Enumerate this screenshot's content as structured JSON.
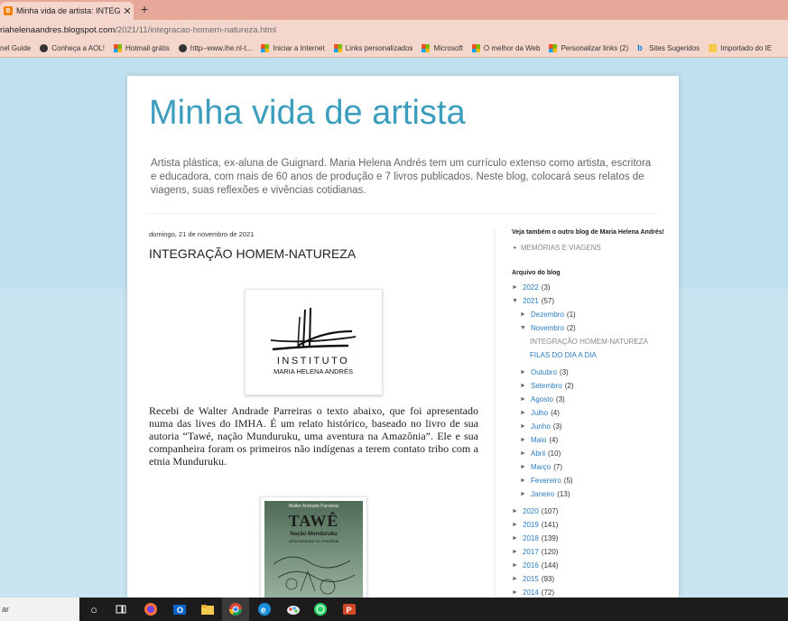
{
  "browser": {
    "tab_title": "Minha vida de artista: INTEGRAÇ",
    "tab_favicon": "B",
    "close_glyph": "✕",
    "new_tab_glyph": "+",
    "url_host": "riahelenaandres.blogspot.com",
    "url_path": "/2021/11/integracao-homem-natureza.html",
    "bookmarks": [
      {
        "label": "nel Guide",
        "icon": "none"
      },
      {
        "label": "Conheça a AOL!",
        "icon": "globe"
      },
      {
        "label": "Hotmail grátis",
        "icon": "ms"
      },
      {
        "label": "http--www.ihe.nl-t...",
        "icon": "globe"
      },
      {
        "label": "Iniciar a Internet",
        "icon": "ms"
      },
      {
        "label": "Links personalizados",
        "icon": "ms"
      },
      {
        "label": "Microsoft",
        "icon": "ms"
      },
      {
        "label": "O melhor da Web",
        "icon": "ms"
      },
      {
        "label": "Personalizar links (2)",
        "icon": "ms"
      },
      {
        "label": "Sites Sugeridos",
        "icon": "bing"
      },
      {
        "label": "Importado do IE",
        "icon": "folder"
      }
    ]
  },
  "blog": {
    "title": "Minha vida de artista",
    "description": "Artista plástica, ex-aluna de Guignard. Maria Helena Andrés tem um currículo extenso como artista, escritora e educadora, com mais de 60 anos de produção e 7 livros publicados. Neste blog, colocará seus relatos de viagens, suas reflexões e vivências cotidianas."
  },
  "post": {
    "date": "domingo, 21 de novembro de 2021",
    "title": "INTEGRAÇÃO HOMEM-NATUREZA",
    "logo_line1": "INSTITUTO",
    "logo_line2": "MARIA HELENA ANDRÉS",
    "body": "Recebi de Walter Andrade Parreiras o texto abaixo, que foi apresentado numa das lives do IMHA. É um relato histórico, baseado no livro de sua autoria “Tawé, nação Munduruku, uma aventura na Amazônia”. Ele e sua companheira foram os primeiros não indígenas a terem contato tribo com a etnia Munduruku.",
    "book_author": "Walter Andrade Parreiras",
    "book_title": "TAWÊ",
    "book_sub": "Nação Munduruku",
    "book_sub2": "Uma Aventura na Amazônia"
  },
  "sidebar": {
    "other_blog_heading": "Veja também o outro blog de Maria Helena Andrés!",
    "other_blog_link": "MEMÓRIAS E VIAGENS",
    "archive_heading": "Arquivo do blog",
    "arrow_collapsed": "►",
    "arrow_expanded": "▼",
    "years": [
      {
        "year": "2022",
        "count": "(3)"
      },
      {
        "year": "2021",
        "count": "(57)"
      }
    ],
    "months_2021_before": [
      {
        "month": "Dezembro",
        "count": "(1)"
      }
    ],
    "current_month": {
      "month": "Novembro",
      "count": "(2)"
    },
    "current_posts": [
      "INTEGRAÇÃO HOMEM-NATUREZA",
      "FILAS DO DIA A DIA"
    ],
    "months_2021_after": [
      {
        "month": "Outubro",
        "count": "(3)"
      },
      {
        "month": "Setembro",
        "count": "(2)"
      },
      {
        "month": "Agosto",
        "count": "(3)"
      },
      {
        "month": "Julho",
        "count": "(4)"
      },
      {
        "month": "Junho",
        "count": "(3)"
      },
      {
        "month": "Maio",
        "count": "(4)"
      },
      {
        "month": "Abril",
        "count": "(10)"
      },
      {
        "month": "Março",
        "count": "(7)"
      },
      {
        "month": "Fevereiro",
        "count": "(5)"
      },
      {
        "month": "Janeiro",
        "count": "(13)"
      }
    ],
    "older_years": [
      {
        "year": "2020",
        "count": "(107)"
      },
      {
        "year": "2019",
        "count": "(141)"
      },
      {
        "year": "2018",
        "count": "(139)"
      },
      {
        "year": "2017",
        "count": "(120)"
      },
      {
        "year": "2016",
        "count": "(144)"
      },
      {
        "year": "2015",
        "count": "(93)"
      },
      {
        "year": "2014",
        "count": "(72)"
      }
    ]
  },
  "taskbar": {
    "search_text": "ar",
    "icons": [
      "cortana-icon",
      "task-view-icon",
      "firefox-icon",
      "outlook-icon",
      "file-explorer-icon",
      "chrome-icon",
      "edge-icon",
      "paint-icon",
      "whatsapp-icon",
      "powerpoint-icon"
    ]
  }
}
